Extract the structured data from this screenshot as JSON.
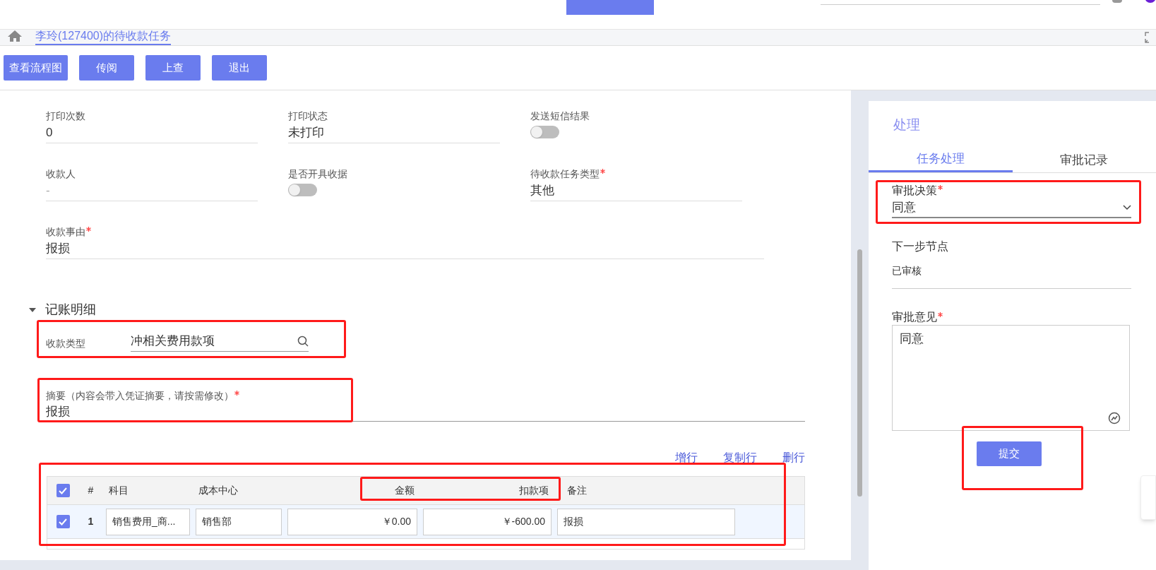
{
  "page_tab": {
    "label": "李玲(127400)的待收款任务",
    "selected": true
  },
  "toolbar": [
    "查看流程图",
    "传阅",
    "上查",
    "退出"
  ],
  "fields": [
    {
      "kind": "text",
      "label": "打印次数",
      "value": "0",
      "required": false
    },
    {
      "kind": "text",
      "label": "打印状态",
      "value": "未打印",
      "required": false
    },
    {
      "kind": "toggle",
      "label": "发送短信结果",
      "on": false,
      "required": false
    },
    {
      "kind": "text",
      "label": "收款人",
      "placeholder": "-",
      "required": false
    },
    {
      "kind": "toggle",
      "label": "是否开具收据",
      "on": false,
      "required": false
    },
    {
      "kind": "text",
      "label": "待收款任务类型",
      "value": "其他",
      "required": true
    }
  ],
  "reason": {
    "label": "收款事由",
    "value": "报损",
    "required": true
  },
  "section": {
    "title": "记账明细",
    "expanded": true
  },
  "receipt_type": {
    "label": "收款类型",
    "value": "冲相关费用款项"
  },
  "summary": {
    "label": "摘要（内容会带入凭证摘要，请按需修改）",
    "value": "报损",
    "required": true
  },
  "table_actions": [
    "增行",
    "复制行",
    "删行"
  ],
  "table": {
    "all_checked": true,
    "columns": [
      "#",
      "科目",
      "成本中心",
      "金额",
      "扣款项",
      "备注"
    ],
    "rows": [
      {
        "checked": true,
        "cells": [
          "1",
          "销售费用_商...",
          "销售部",
          "￥0.00",
          "￥-600.00",
          "报损"
        ]
      }
    ]
  },
  "panel": {
    "title": "处理",
    "tabs": [
      {
        "label": "任务处理",
        "selected": true
      },
      {
        "label": "审批记录",
        "selected": false
      }
    ],
    "decision": {
      "label": "审批决策",
      "value": "同意",
      "required": true
    },
    "next_node": {
      "label": "下一步节点",
      "value": "已审核"
    },
    "opinion": {
      "label": "审批意见",
      "value": "同意",
      "required": true
    },
    "submit": "提交"
  }
}
